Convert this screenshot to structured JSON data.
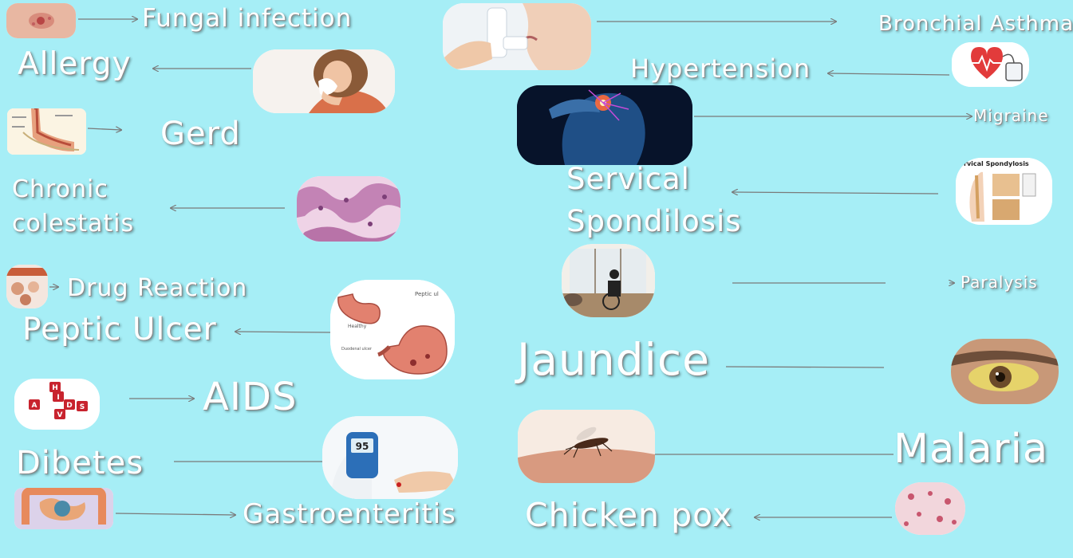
{
  "labels": {
    "fungal": "Fungal infection",
    "allergy": "Allergy",
    "gerd": "Gerd",
    "chronic_line1": "Chronic",
    "chronic_line2": "colestatis",
    "drug": "Drug Reaction",
    "peptic": "Peptic Ulcer",
    "aids": "AIDS",
    "dibetes": "Dibetes",
    "gastro": "Gastroenteritis",
    "asthma": "Bronchial Asthma",
    "hypertension": "Hypertension",
    "migraine": "Migraine",
    "servical_line1": "Servical",
    "servical_line2": "Spondilosis",
    "paralysis": "Paralysis",
    "jaundice": "Jaundice",
    "malaria": "Malaria",
    "chickenpox": "Chicken pox"
  },
  "image_text": {
    "spondylosis_title": "rvical Spondylosis",
    "ulcer_healthy": "Healthy",
    "ulcer_peptic": "Peptic ul",
    "ulcer_duodenal": "Duodenal ulcer",
    "aids_h": "H",
    "aids_i": "I",
    "aids_v": "V",
    "aids_a": "A",
    "aids_d": "D",
    "aids_s": "S",
    "glucose_reading": "95"
  },
  "colors": {
    "background": "#a6eef6",
    "label_text": "#ffffff",
    "arrow": "#7a7a7a"
  }
}
